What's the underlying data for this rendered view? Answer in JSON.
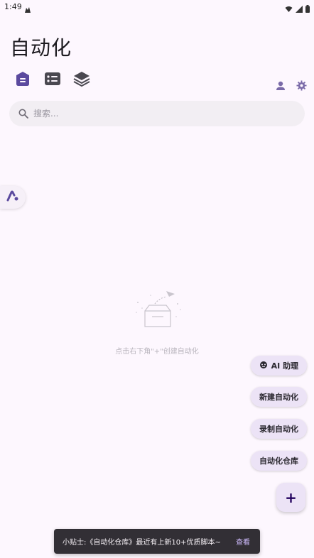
{
  "status_bar": {
    "time": "1:49"
  },
  "header": {
    "title": "自动化"
  },
  "tabs": [
    {
      "icon": "home-icon",
      "active": true
    },
    {
      "icon": "list-icon",
      "active": false
    },
    {
      "icon": "layers-icon",
      "active": false
    }
  ],
  "search": {
    "placeholder": "搜索...",
    "value": ""
  },
  "empty_state": {
    "message": "点击右下角\"+\"创建自动化"
  },
  "fab_menu": {
    "ai_label": "AI 助理",
    "new_label": "新建自动化",
    "record_label": "录制自动化",
    "repo_label": "自动化仓库",
    "main_label": "+"
  },
  "snackbar": {
    "message": "小贴士:《自动化仓库》最近有上新10+优质脚本~",
    "action": "查看"
  },
  "colors": {
    "background": "#fdf7fe",
    "accent": "#5b4a9e",
    "fab": "#ece3f6",
    "snackbar": "#322f35"
  }
}
